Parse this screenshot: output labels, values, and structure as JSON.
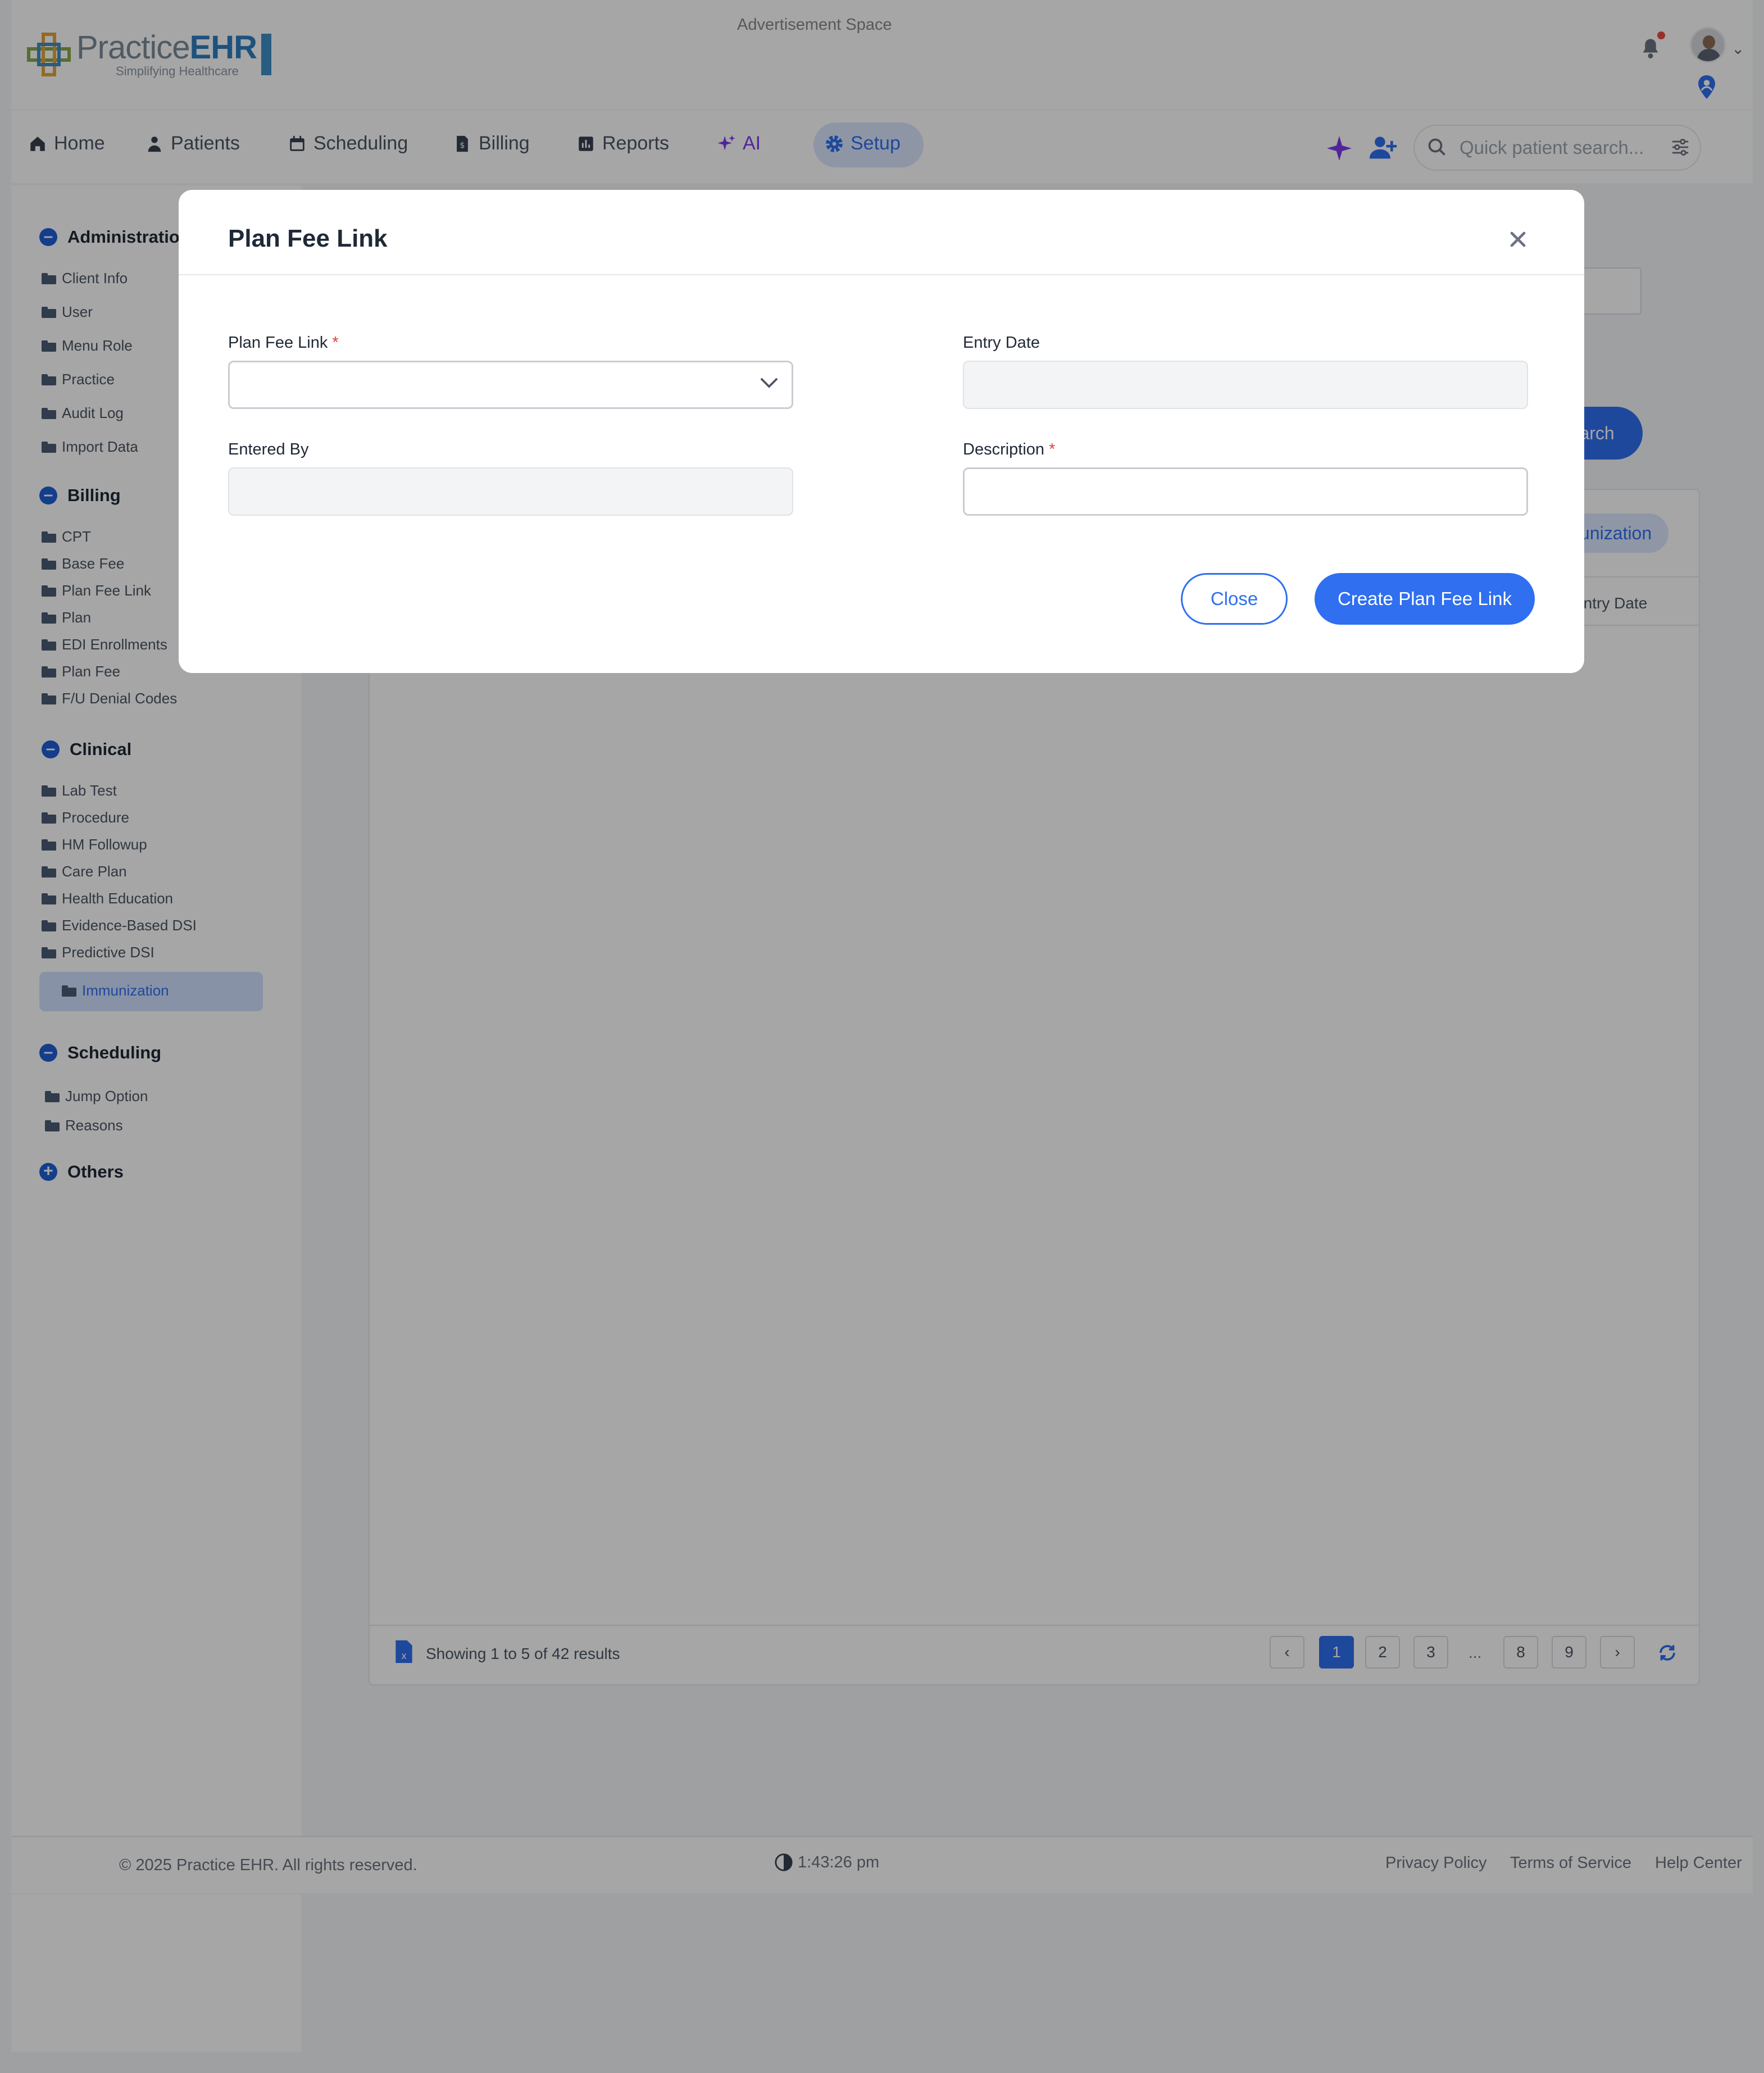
{
  "header": {
    "logo": {
      "brand_light": "Practice",
      "brand_bold": "EHR",
      "tagline": "Simplifying Healthcare"
    },
    "advertisement": "Advertisement Space",
    "icons": [
      "bell-icon",
      "avatar",
      "chevron-down-icon",
      "location-pin-icon"
    ]
  },
  "nav": {
    "items": [
      {
        "label": "Home",
        "icon": "home-icon"
      },
      {
        "label": "Patients",
        "icon": "patient-icon"
      },
      {
        "label": "Scheduling",
        "icon": "calendar-icon"
      },
      {
        "label": "Billing",
        "icon": "billing-icon"
      },
      {
        "label": "Reports",
        "icon": "reports-icon"
      },
      {
        "label": "AI",
        "icon": "sparkle-icon"
      },
      {
        "label": "Setup",
        "icon": "gear-icon"
      }
    ],
    "active": "Setup",
    "search_placeholder": "Quick patient search..."
  },
  "sidebar": {
    "sections": [
      {
        "title": "Administration",
        "items": [
          "Client Info",
          "User",
          "Menu Role",
          "Practice",
          "Audit Log",
          "Import Data"
        ]
      },
      {
        "title": "Billing",
        "items": [
          "CPT",
          "Base Fee",
          "Plan Fee Link",
          "Plan",
          "EDI Enrollments",
          "Plan Fee",
          "F/U Denial Codes"
        ]
      },
      {
        "title": "Clinical",
        "items": [
          "Lab Test",
          "Procedure",
          "HM Followup",
          "Care Plan",
          "Health Education",
          "Evidence-Based DSI",
          "Predictive DSI",
          "Immunization"
        ]
      },
      {
        "title": "Scheduling",
        "items": [
          "Jump Option",
          "Reasons"
        ]
      },
      {
        "title": "Others",
        "items": []
      }
    ],
    "active_item": "Immunization"
  },
  "background": {
    "search_button": "Search",
    "tab_label": "Immunization",
    "column_header": "Entry Date",
    "showing": "Showing 1 to 5 of 42 results",
    "pages": [
      "1",
      "2",
      "3",
      "...",
      "8",
      "9"
    ],
    "current_page": "1"
  },
  "footer": {
    "copyright": "© 2025 Practice EHR. All rights reserved.",
    "time": "1:43:26 pm",
    "links": [
      "Privacy Policy",
      "Terms of Service",
      "Help Center"
    ]
  },
  "modal": {
    "title": "Plan Fee Link",
    "fields": {
      "plan_fee_link": {
        "label": "Plan Fee Link",
        "required": "*",
        "value": ""
      },
      "entry_date": {
        "label": "Entry Date",
        "value": ""
      },
      "entered_by": {
        "label": "Entered By",
        "value": ""
      },
      "description": {
        "label": "Description",
        "required": "*",
        "value": ""
      }
    },
    "close_label": "Close",
    "create_label": "Create Plan Fee Link"
  },
  "colors": {
    "primary": "#2f6ff0",
    "required": "#e53e3e",
    "overlay": "rgba(0,0,0,0.35)"
  }
}
